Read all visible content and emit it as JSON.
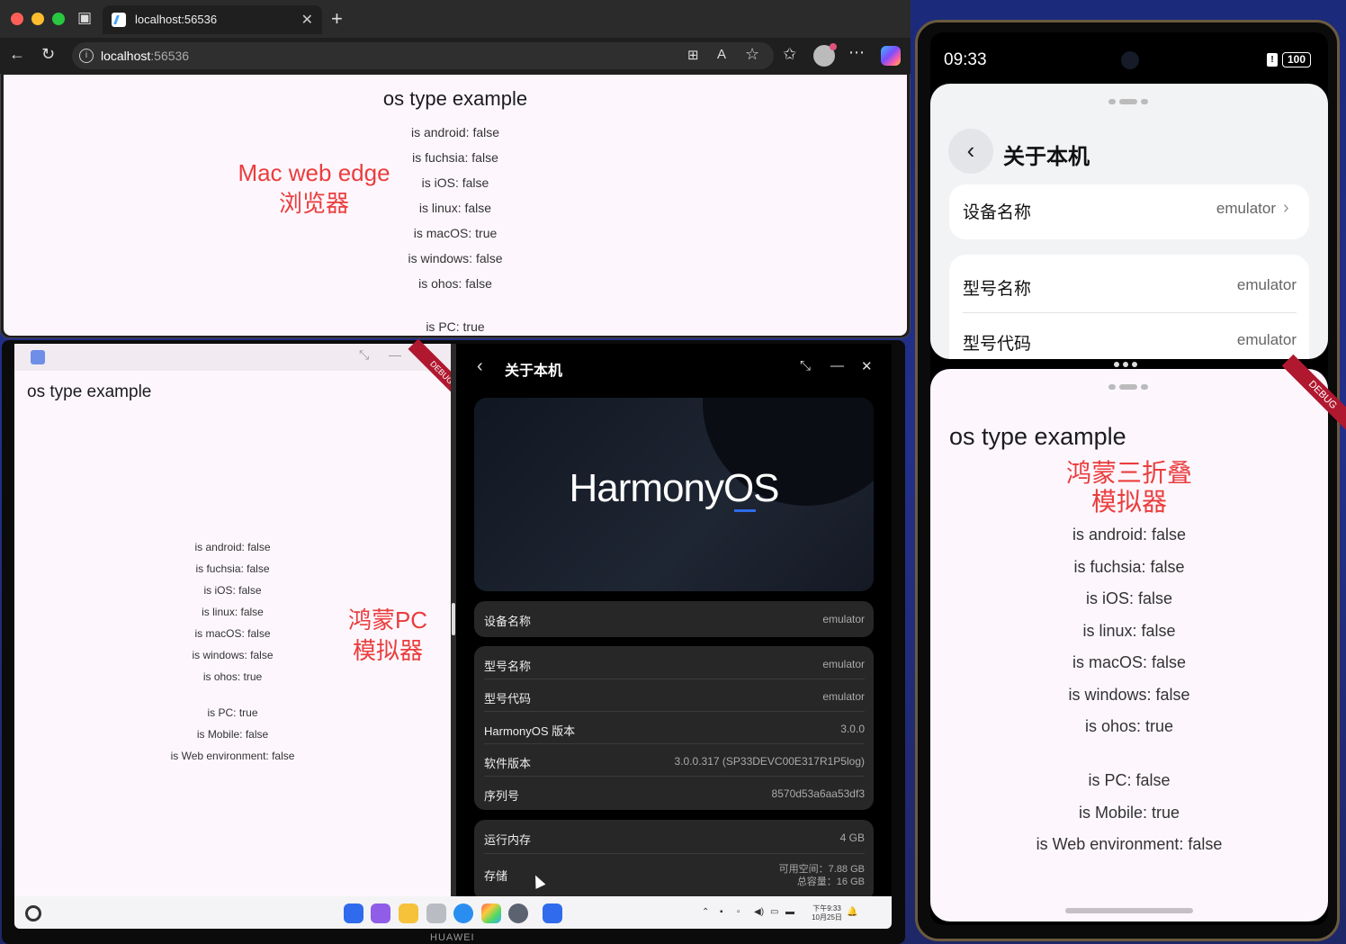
{
  "browser": {
    "tab_title": "localhost:56536",
    "url_host": "localhost",
    "url_port": ":56536",
    "accent": "#45a3ff"
  },
  "web_app": {
    "title": "os type example",
    "lines": [
      "is android: false",
      "is fuchsia: false",
      "is iOS: false",
      "is linux: false",
      "is macOS: true",
      "is windows: false",
      "is ohos: false"
    ],
    "lines2": [
      "is PC: true"
    ],
    "note_line1": "Mac web edge",
    "note_line2": "浏览器",
    "note_color": "#ea3d3d"
  },
  "pc_app": {
    "title": "os type example",
    "debug": "DEBUG",
    "lines": [
      "is android: false",
      "is fuchsia: false",
      "is iOS: false",
      "is linux: false",
      "is macOS: false",
      "is windows: false",
      "is ohos: true"
    ],
    "lines2": [
      "is PC: true",
      "is Mobile: false",
      "is Web environment: false"
    ],
    "note_line1": "鸿蒙PC",
    "note_line2": "模拟器"
  },
  "pc_settings": {
    "title": "关于本机",
    "hero_logo": "HarmonyOS",
    "card1": [
      {
        "label": "设备名称",
        "value": "emulator"
      }
    ],
    "card2": [
      {
        "label": "型号名称",
        "value": "emulator"
      },
      {
        "label": "型号代码",
        "value": "emulator"
      },
      {
        "label": "HarmonyOS 版本",
        "value": "3.0.0"
      },
      {
        "label": "软件版本",
        "value": "3.0.0.317 (SP33DEVC00E317R1P5log)"
      },
      {
        "label": "序列号",
        "value": "8570d53a6aa53df3"
      }
    ],
    "card3": [
      {
        "label": "运行内存",
        "value": "4 GB"
      },
      {
        "label": "存储",
        "value": "可用空间：7.88 GB",
        "value2": "总容量：16 GB"
      }
    ]
  },
  "taskbar": {
    "time": "下午9:33",
    "date": "10月25日",
    "brand": "HUAWEI"
  },
  "phone": {
    "status_time": "09:33",
    "battery": "100",
    "settings_title": "关于本机",
    "rows": [
      {
        "label": "设备名称",
        "value": "emulator"
      },
      {
        "label": "型号名称",
        "value": "emulator"
      },
      {
        "label": "型号代码",
        "value": "emulator"
      }
    ],
    "app_title": "os type example",
    "debug": "DEBUG",
    "note_line1": "鸿蒙三折叠",
    "note_line2": "模拟器",
    "lines": [
      "is android: false",
      "is fuchsia: false",
      "is iOS: false",
      "is linux: false",
      "is macOS: false",
      "is windows: false",
      "is ohos: true"
    ],
    "lines2": [
      "is PC: false",
      "is Mobile: true",
      "is Web environment: false"
    ]
  }
}
